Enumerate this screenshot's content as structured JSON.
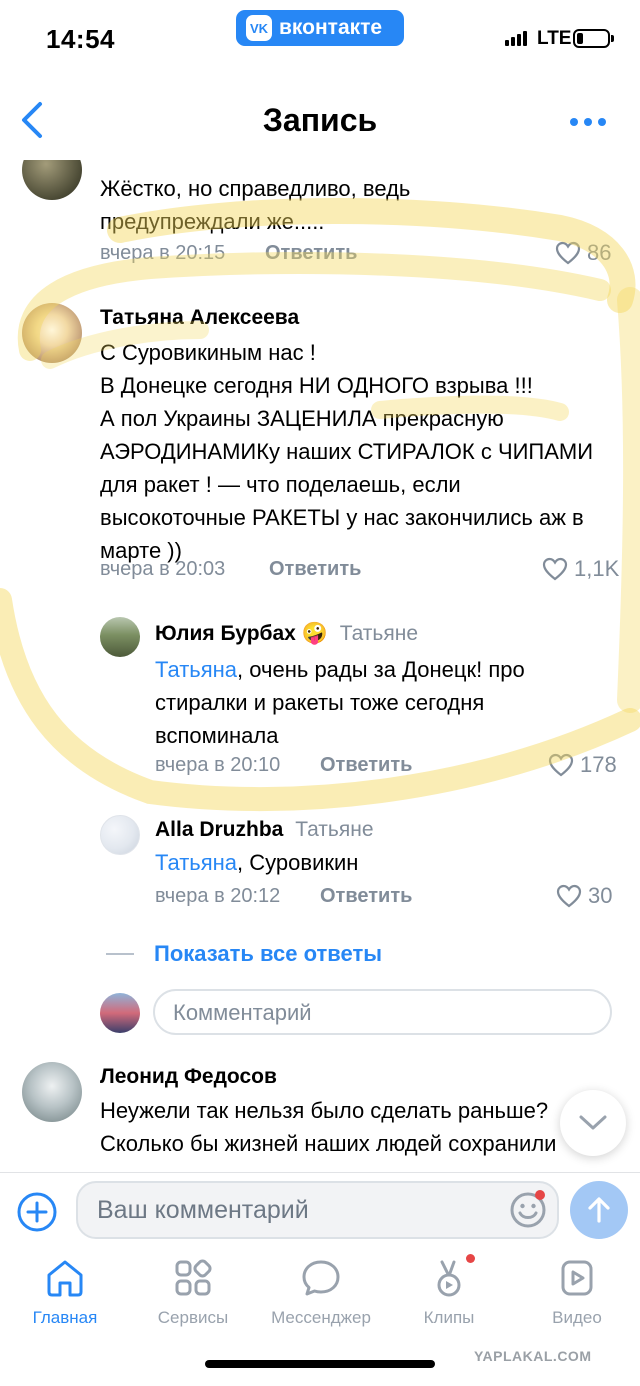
{
  "status_bar": {
    "time": "14:54",
    "app_badge": "вконтакте",
    "network": "LTE",
    "battery_fraction": 0.22
  },
  "header": {
    "title": "Запись"
  },
  "comments": [
    {
      "text_lines": [
        "Жёстко, но справедливо, ведь",
        "предупреждали же....."
      ],
      "time": "вчера в 20:15",
      "reply_label": "Ответить",
      "likes": "86"
    },
    {
      "author": "Татьяна Алексеева",
      "text": "С Суровикиным нас !\nВ Донецке сегодня НИ ОДНОГО взрыва !!!\n А пол Украины ЗАЦЕНИЛА прекрасную АЭРОДИНАМИКу наших СТИРАЛОК с ЧИПАМИ для ракет ! — что поделаешь, если высокоточные РАКЕТЫ у нас закончились аж в марте ))",
      "time": "вчера в 20:03",
      "reply_label": "Ответить",
      "likes": "1,1K"
    },
    {
      "author": "Юлия Бурбах",
      "author_emoji": "🤪",
      "reply_to": "Татьяне",
      "mention": "Татьяна",
      "text": ", очень рады за Донецк! про стиралки и ракеты тоже сегодня вспоминала",
      "time": "вчера в 20:10",
      "reply_label": "Ответить",
      "likes": "178"
    },
    {
      "author": "Alla Druzhba",
      "reply_to": "Татьяне",
      "mention": "Татьяна",
      "text": ", Суровикин",
      "time": "вчера в 20:12",
      "reply_label": "Ответить",
      "likes": "30"
    },
    {
      "author": "Леонид Федосов",
      "text": "Неужели так нельзя было сделать раньше?\nСколько бы жизней наших людей сохранили"
    }
  ],
  "show_all_replies": "Показать все ответы",
  "comment_placeholder": "Комментарий",
  "input_placeholder": "Ваш комментарий",
  "tabs": [
    {
      "label": "Главная",
      "icon": "home-icon",
      "active": true
    },
    {
      "label": "Сервисы",
      "icon": "services-icon",
      "active": false
    },
    {
      "label": "Мессенджер",
      "icon": "messenger-icon",
      "active": false
    },
    {
      "label": "Клипы",
      "icon": "clips-icon",
      "active": false
    },
    {
      "label": "Видео",
      "icon": "video-icon",
      "active": false
    }
  ],
  "watermark": "YAPLAKAL.COM",
  "colors": {
    "accent": "#2787f5",
    "secondary_text": "#818c99",
    "highlighter": "#f3d75a",
    "send_button": "#a3c8f5"
  }
}
